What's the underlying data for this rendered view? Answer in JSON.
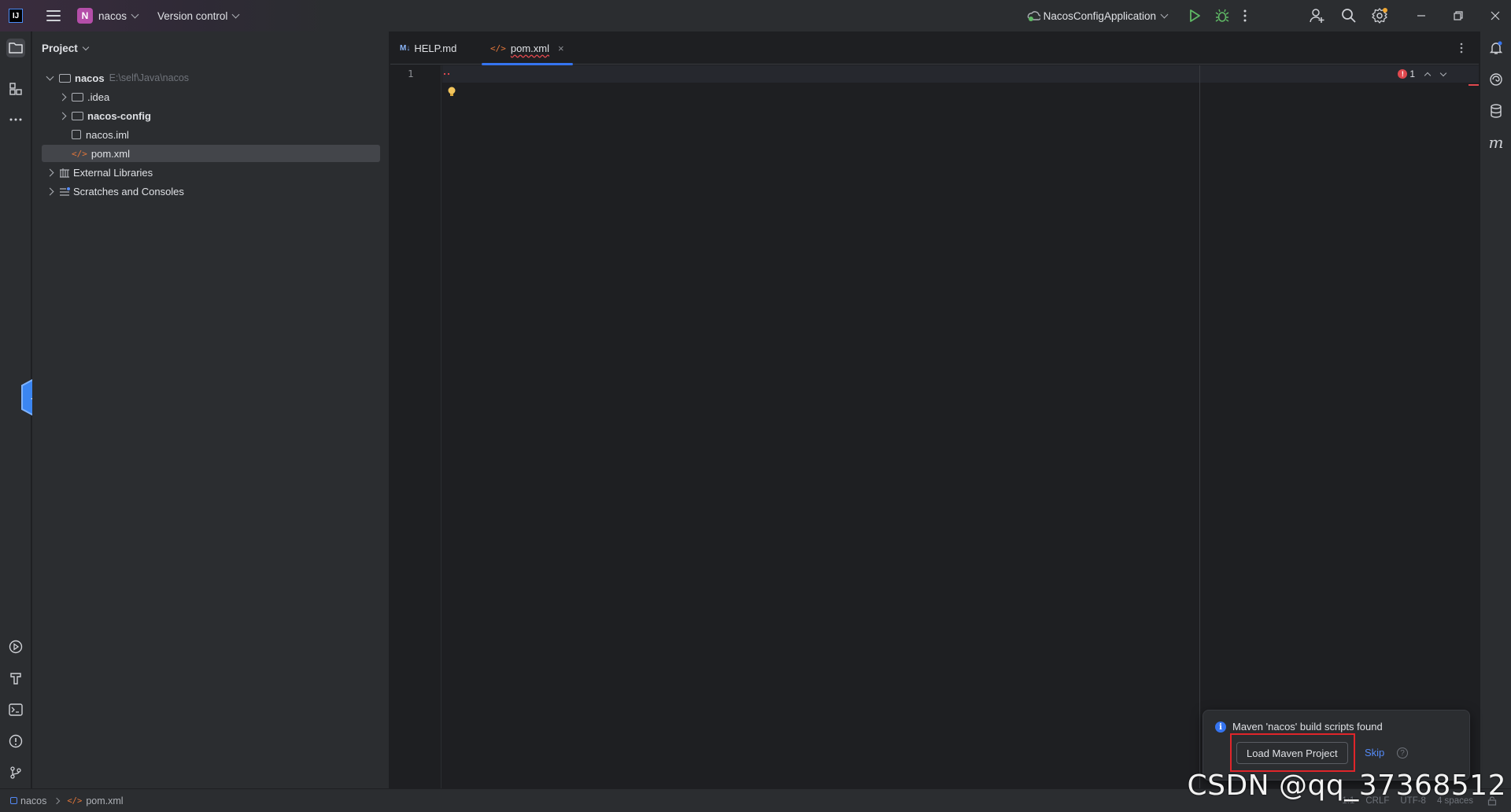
{
  "titlebar": {
    "project_badge": "N",
    "project_name": "nacos",
    "vcs_label": "Version control",
    "run_config": "NacosConfigApplication",
    "app_logo": "IJ"
  },
  "project_panel": {
    "title": "Project",
    "tree": [
      {
        "label": "nacos",
        "path": "E:\\self\\Java\\nacos"
      },
      {
        "label": ".idea"
      },
      {
        "label": "nacos-config"
      },
      {
        "label": "nacos.iml"
      },
      {
        "label": "pom.xml"
      },
      {
        "label": "External Libraries"
      },
      {
        "label": "Scratches and Consoles"
      }
    ]
  },
  "editor": {
    "tabs": [
      {
        "label": "HELP.md",
        "badge": "M↓"
      },
      {
        "label": "pom.xml",
        "badge": "</>"
      }
    ],
    "line_numbers": [
      "1"
    ],
    "error_count": "1"
  },
  "notification": {
    "info_glyph": "i",
    "title": "Maven 'nacos' build scripts found",
    "load_button": "Load Maven Project",
    "skip": "Skip",
    "help_glyph": "?"
  },
  "statusbar": {
    "breadcrumb_project": "nacos",
    "breadcrumb_file": "pom.xml",
    "position": "1:1",
    "line_sep": "CRLF",
    "encoding": "UTF-8",
    "indent": "4 spaces"
  },
  "watermark": "CSDN @qq_37368512",
  "colors": {
    "accent": "#3574f0",
    "highlight_box": "#e0252a",
    "run_green": "#5fb865",
    "error_red": "#e0484e"
  }
}
